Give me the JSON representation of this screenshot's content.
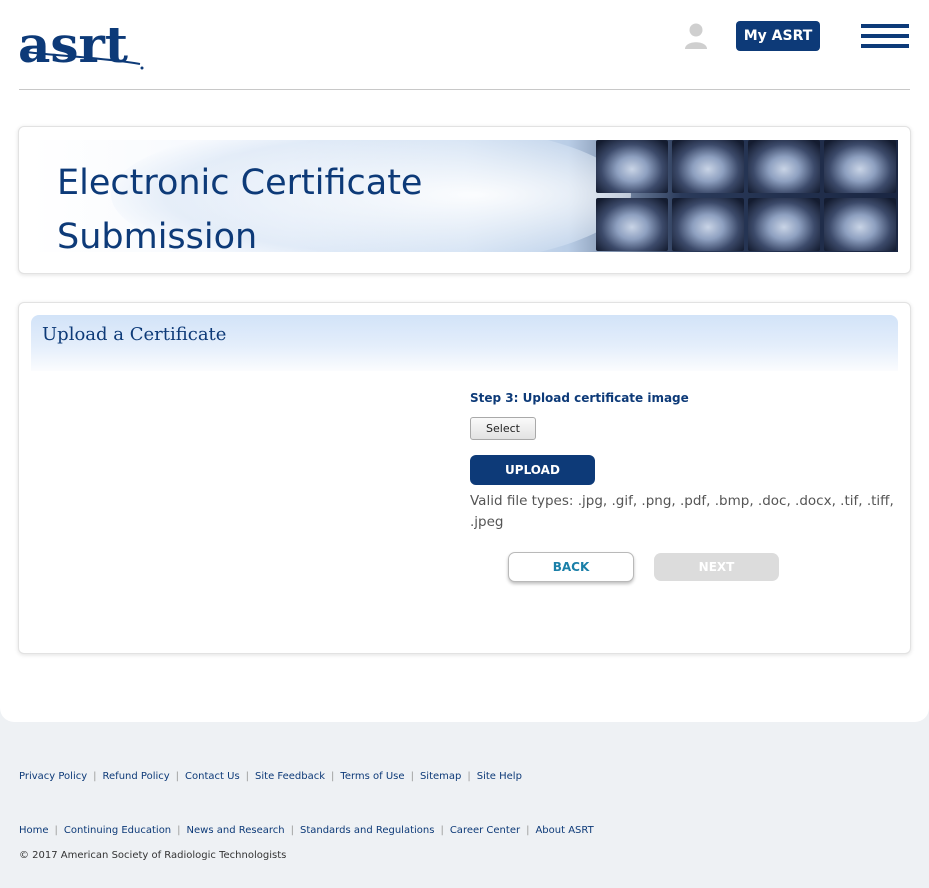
{
  "header": {
    "logo_text": "asrt",
    "my_asrt_label": "My ASRT"
  },
  "banner": {
    "title_line1": "Electronic Certificate",
    "title_line2": "Submission"
  },
  "upload": {
    "heading": "Upload a Certificate",
    "step_label": "Step 3: Upload certificate image",
    "select_label": "Select",
    "upload_label": "UPLOAD",
    "valid_types": "Valid file types:  .jpg, .gif, .png, .pdf, .bmp, .doc, .docx, .tif, .tiff, .jpeg",
    "back_label": "BACK",
    "next_label": "NEXT"
  },
  "footer": {
    "row1": [
      "Privacy Policy",
      "Refund Policy",
      "Contact Us",
      "Site Feedback",
      "Terms of Use",
      "Sitemap",
      "Site Help"
    ],
    "row2": [
      "Home",
      "Continuing Education",
      "News and Research",
      "Standards and Regulations",
      "Career Center",
      "About ASRT"
    ],
    "copyright": "© 2017 American Society of Radiologic Technologists"
  },
  "colors": {
    "brand_navy": "#0d3a78",
    "back_text": "#1a7fa8",
    "disabled_gray": "#dcdcdc"
  }
}
